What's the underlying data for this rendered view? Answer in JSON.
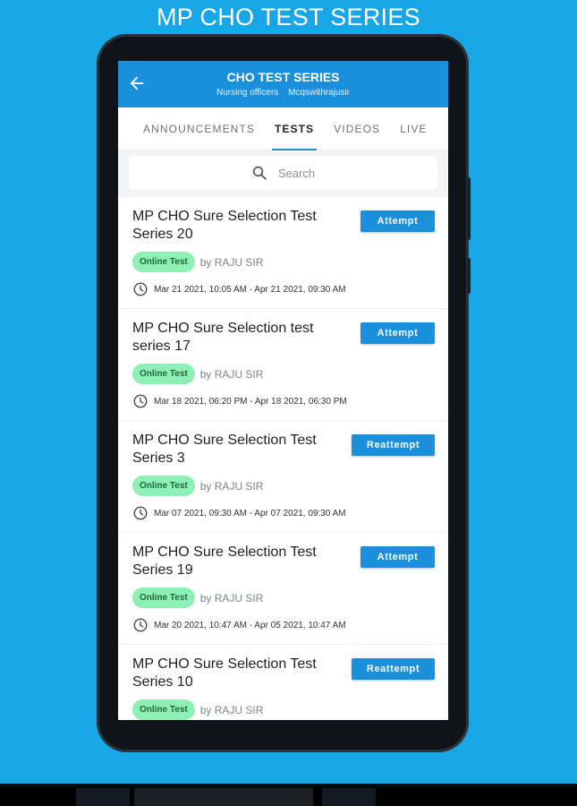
{
  "banner_title": "MP CHO TEST SERIES",
  "appbar": {
    "title": "CHO TEST SERIES",
    "subtitle_left": "Nursing officers",
    "subtitle_right": "Mcqswithrajusir"
  },
  "tabs": [
    {
      "label": "ANNOUNCEMENTS",
      "active": false
    },
    {
      "label": "TESTS",
      "active": true
    },
    {
      "label": "VIDEOS",
      "active": false
    },
    {
      "label": "LIVE",
      "active": false
    }
  ],
  "search": {
    "placeholder": "Search"
  },
  "tests": [
    {
      "title": "MP CHO Sure Selection Test Series 20",
      "button": "Attempt",
      "badge": "Online Test",
      "author": "by RAJU SIR",
      "dates": "Mar 21 2021, 10:05 AM - Apr 21 2021, 09:30 AM"
    },
    {
      "title": "MP CHO Sure Selection test series 17",
      "button": "Attempt",
      "badge": "Online Test",
      "author": "by RAJU SIR",
      "dates": "Mar 18 2021, 06:20 PM - Apr 18 2021, 06:30 PM"
    },
    {
      "title": "MP CHO Sure Selection Test Series 3",
      "button": "Reattempt",
      "badge": "Online Test",
      "author": "by RAJU SIR",
      "dates": "Mar 07 2021, 09:30 AM - Apr 07 2021, 09:30 AM"
    },
    {
      "title": "MP CHO Sure Selection Test Series 19",
      "button": "Attempt",
      "badge": "Online Test",
      "author": "by RAJU SIR",
      "dates": "Mar 20 2021, 10:47 AM - Apr 05 2021, 10:47 AM"
    },
    {
      "title": "MP CHO Sure Selection Test Series 10",
      "button": "Reattempt",
      "badge": "Online Test",
      "author": "by RAJU SIR",
      "dates": ""
    }
  ],
  "icons": {
    "back": "arrow-left-icon",
    "search": "search-icon",
    "clock": "clock-icon"
  },
  "colors": {
    "background": "#18a6e6",
    "appbar": "#1a8fdc",
    "badge": "#8ef0b4"
  }
}
